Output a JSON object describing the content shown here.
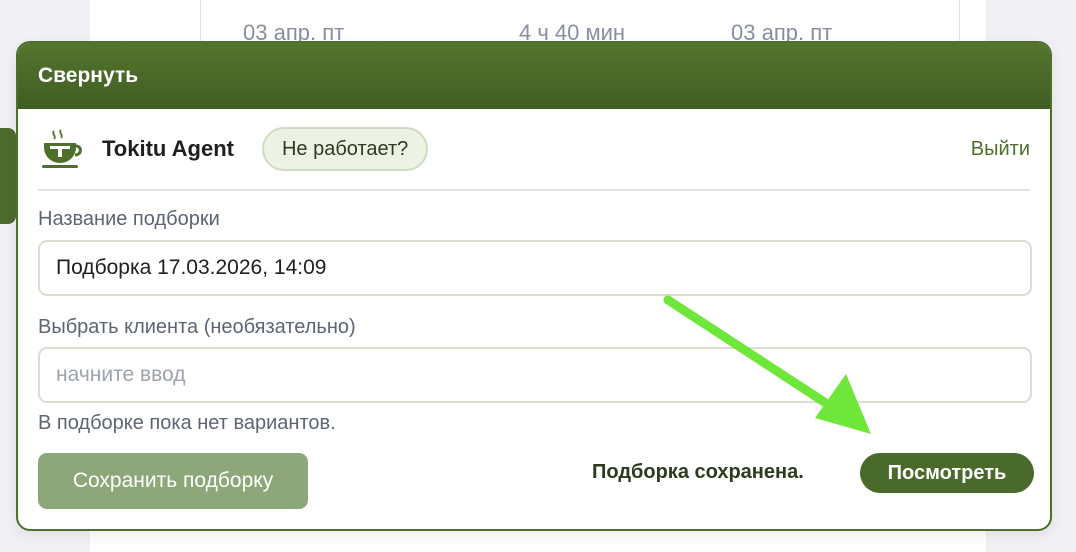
{
  "background": {
    "row": {
      "depart_date": "03 апр. пт",
      "duration": "4 ч 40 мин",
      "arrive_date": "03 апр. пт"
    }
  },
  "widget": {
    "header": {
      "title": "Свернуть"
    },
    "agent": {
      "name": "Tokitu Agent",
      "logo_icon": "teacup-logo-icon",
      "status_label": "Не работает?",
      "logout_label": "Выйти"
    },
    "collection_name": {
      "label": "Название подборки",
      "value": "Подборка 17.03.2026, 14:09"
    },
    "client": {
      "label": "Выбрать клиента (необязательно)",
      "placeholder": "начните ввод",
      "value": ""
    },
    "empty_note": "В подборке пока нет вариантов.",
    "save_button_label": "Сохранить подборку",
    "saved_message": "Подборка сохранена.",
    "view_button_label": "Посмотреть"
  },
  "colors": {
    "brand_green": "#4f6f2d",
    "save_button_disabled": "#8ea77a",
    "annotation_arrow": "#6fe63a"
  }
}
